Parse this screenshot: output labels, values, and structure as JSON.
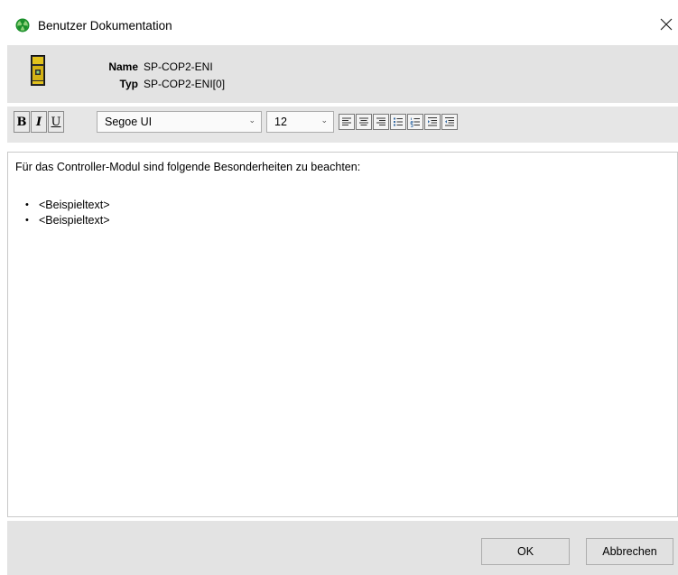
{
  "window": {
    "title": "Benutzer Dokumentation",
    "icon": "green-trefoil-icon",
    "close_icon": "close-icon"
  },
  "module": {
    "icon": "safety-module-icon",
    "name_label": "Name",
    "name_value": "SP-COP2-ENI",
    "type_label": "Typ",
    "type_value": "SP-COP2-ENI[0]"
  },
  "toolbar": {
    "bold_label": "B",
    "italic_label": "I",
    "underline_label": "U",
    "font_family": "Segoe UI",
    "font_size": "12",
    "format_buttons": [
      "align-left",
      "align-center",
      "align-right",
      "bulleted-list",
      "numbered-list",
      "indent",
      "outdent"
    ]
  },
  "editor": {
    "intro": "Für das Controller-Modul sind folgende Besonderheiten zu beachten:",
    "bullet_items": [
      "<Beispieltext>",
      "<Beispieltext>"
    ]
  },
  "buttons": {
    "ok": "OK",
    "cancel": "Abbrechen"
  },
  "colors": {
    "panel_bg": "#e3e3e3",
    "icon_green": "#1a8f2a",
    "module_yellow": "#e2c21c"
  }
}
